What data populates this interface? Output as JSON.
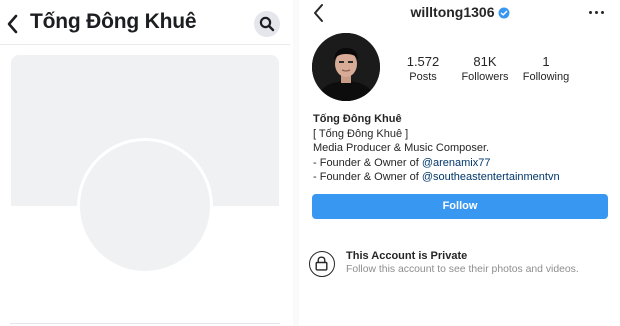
{
  "facebook": {
    "profile_name": "Tống Đông Khuê",
    "icons": {
      "back": "chevron-left-icon",
      "search": "search-icon"
    }
  },
  "instagram": {
    "username": "willtong1306",
    "verified": true,
    "stats": {
      "posts_count": "1.572",
      "posts_label": "Posts",
      "followers_count": "81K",
      "followers_label": "Followers",
      "following_count": "1",
      "following_label": "Following"
    },
    "bio": {
      "name": "Tống Đông Khuê",
      "line1": "[ Tống Đông Khuê ]",
      "line2": "Media Producer & Music Composer.",
      "line3_prefix": "- Founder & Owner of ",
      "line3_mention": "@arenamix77",
      "line4_prefix": "- Founder & Owner of ",
      "line4_mention": "@southeastentertainmentvn"
    },
    "follow_button": "Follow",
    "private": {
      "title": "This Account is Private",
      "subtitle": "Follow this account to see their photos and videos."
    },
    "colors": {
      "accent": "#3897f0",
      "verified": "#3897f0",
      "mention": "#00376b"
    },
    "icons": {
      "back": "chevron-left-icon",
      "more": "more-dots-icon",
      "lock": "lock-icon",
      "verified": "verified-badge-icon"
    }
  }
}
